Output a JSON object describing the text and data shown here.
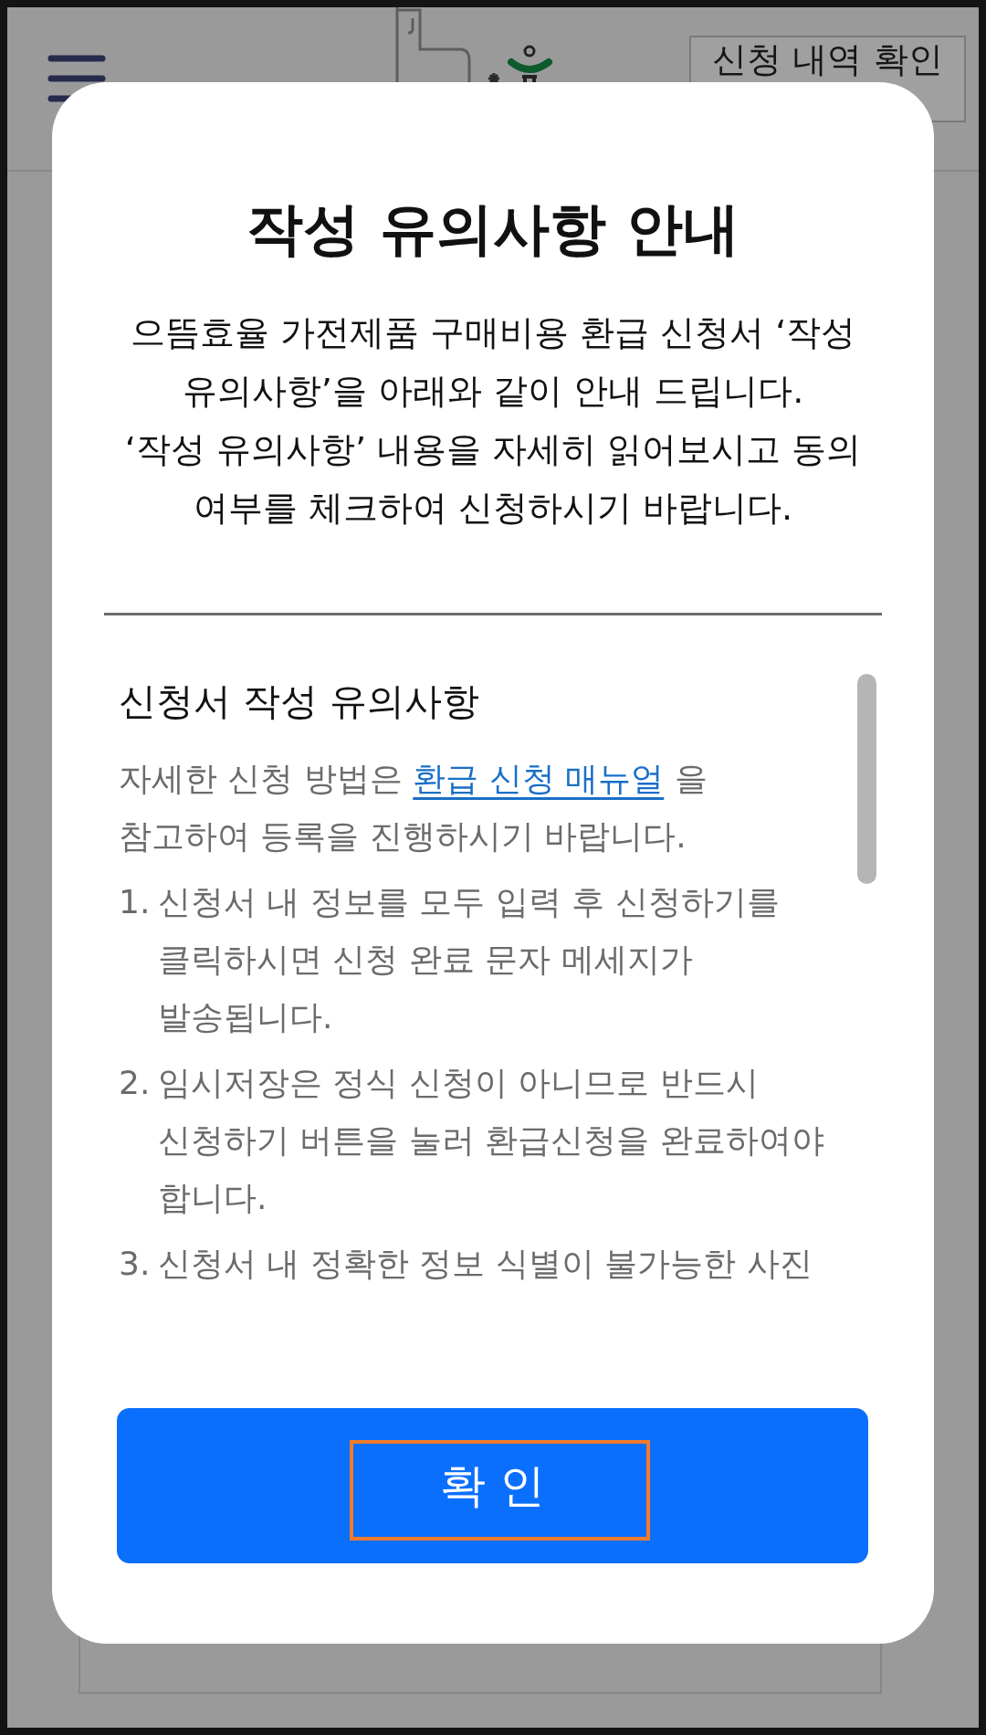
{
  "header": {
    "history_button": {
      "label": "신청 내역 확인"
    }
  },
  "dialog": {
    "title": "작성 유의사항 안내",
    "intro": [
      "으뜸효율 가전제품 구매비용 환급 신청서 ‘작성 유의사항’을 아래와 같이 안내 드립니다.",
      "‘작성 유의사항’ 내용을 자세히 읽어보시고 동의 여부를 체크하여 신청하시기 바랍니다."
    ],
    "notice": {
      "heading": "신청서 작성 유의사항",
      "guide": {
        "before": "자세한 신청 방법은",
        "link": "환급 신청 매뉴얼",
        "after": "을 참고하여 등록을 진행하시기 바랍니다."
      },
      "items": [
        {
          "number": "1.",
          "text": "신청서 내 정보를 모두 입력 후 신청하기를 클릭하시면 신청 완료 문자 메세지가 발송됩니다."
        },
        {
          "number": "2.",
          "text": "임시저장은 정식 신청이 아니므로 반드시 신청하기 버튼을 눌러 환급신청을 완료하여야 합니다."
        },
        {
          "number": "3.",
          "text": "신청서 내 정확한 정보 식별이 불가능한 사진"
        }
      ]
    },
    "confirm_button": {
      "label": "확 인",
      "highlighted": true
    }
  }
}
